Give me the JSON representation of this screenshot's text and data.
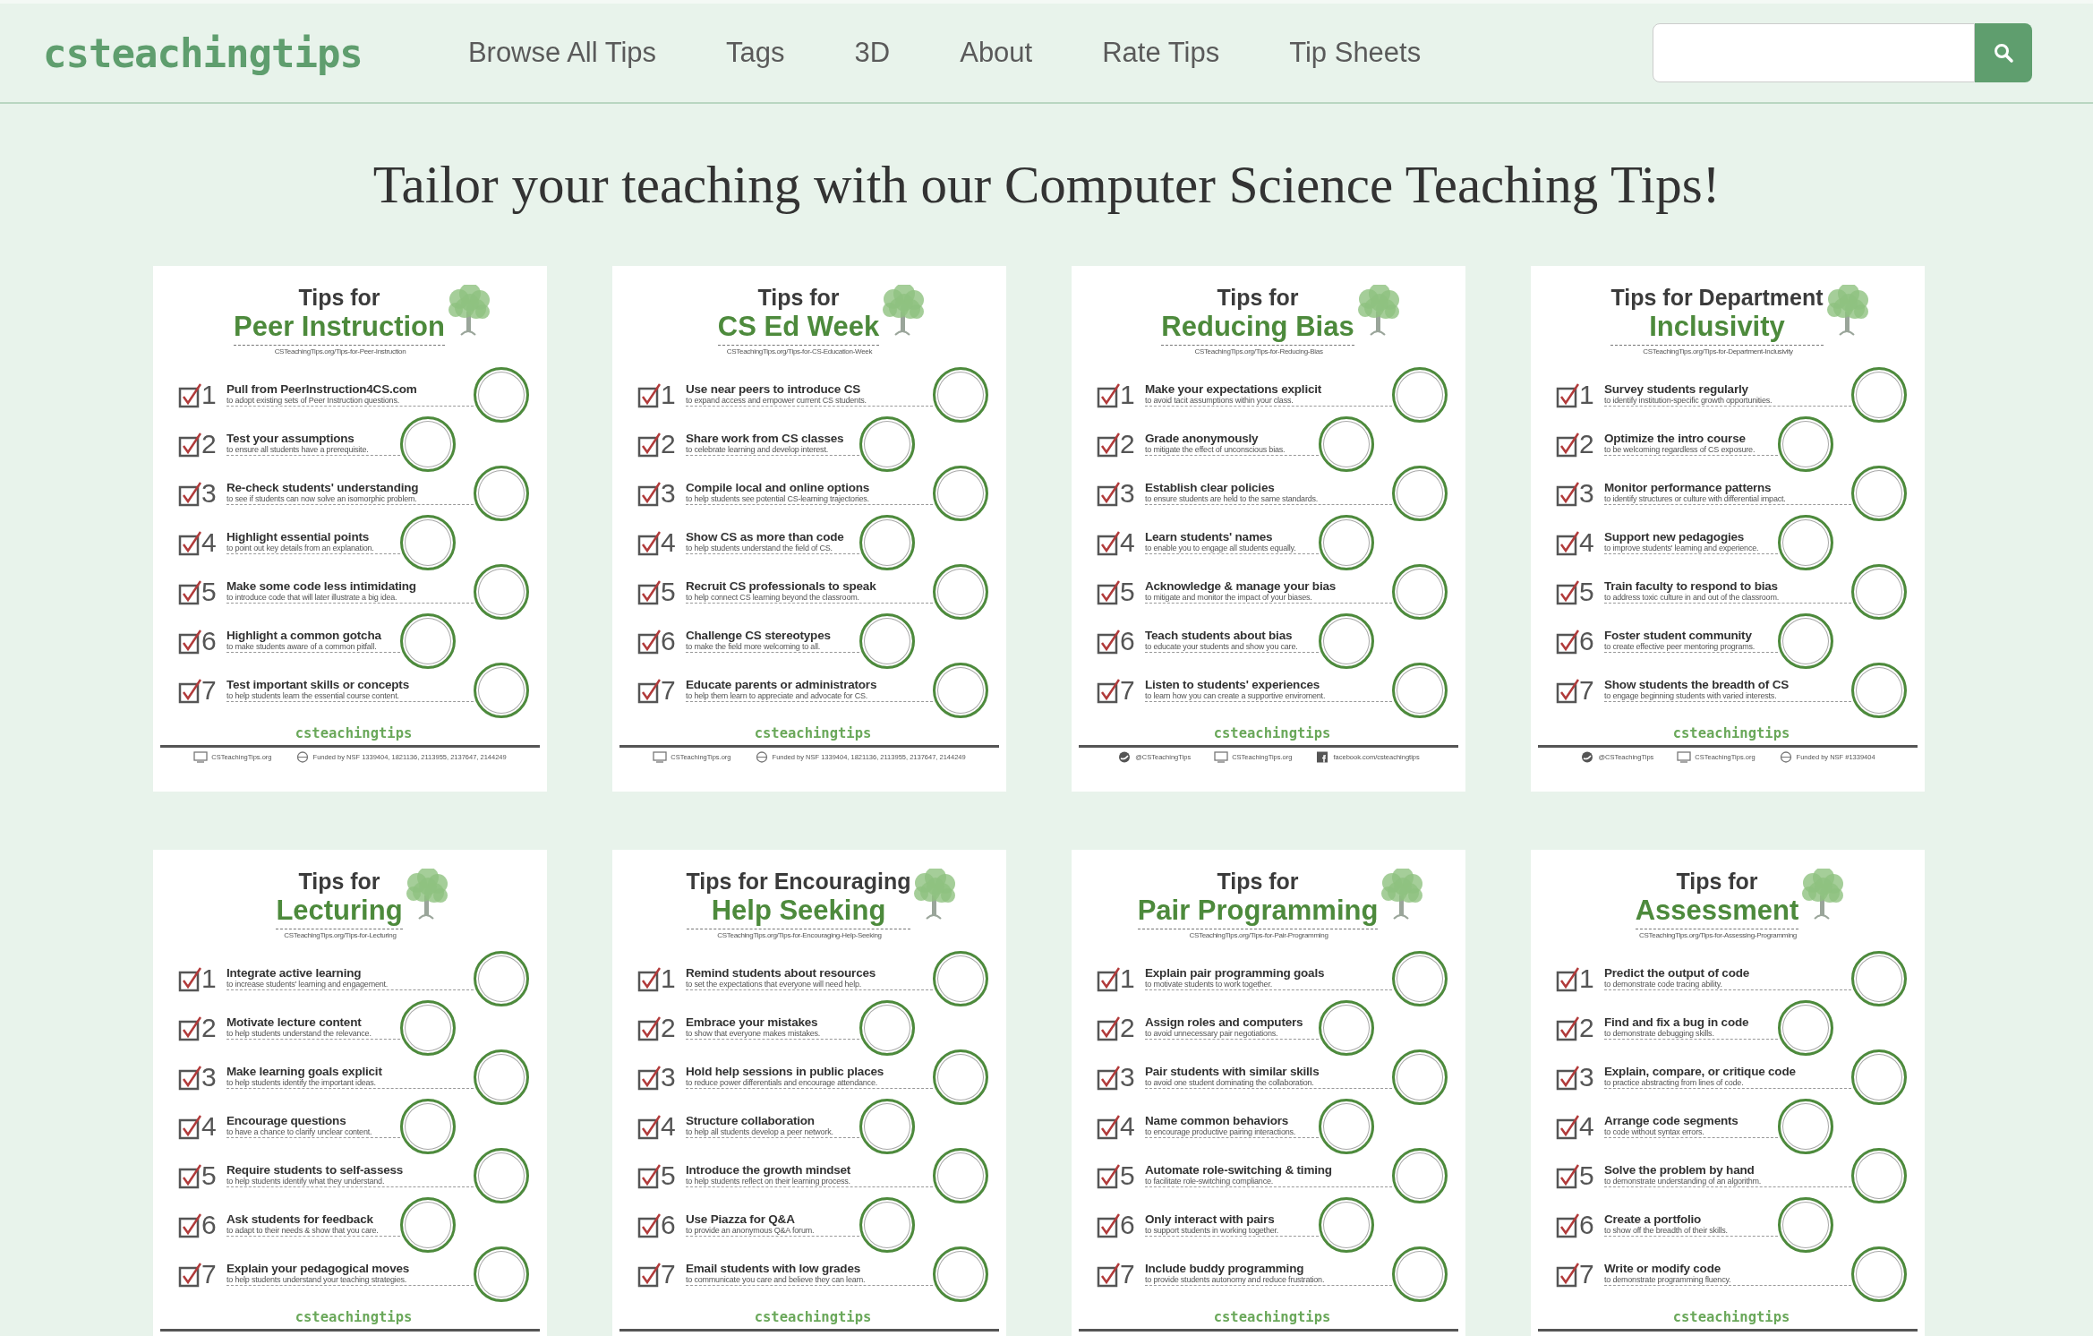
{
  "navbar": {
    "logo": "csteachingtips",
    "links": [
      "Browse All Tips",
      "Tags",
      "3D",
      "About",
      "Rate Tips",
      "Tip Sheets"
    ]
  },
  "heading": "Tailor your teaching with our Computer Science Teaching Tips!",
  "sheets": [
    {
      "title_top": "Tips for",
      "title_main": "Peer Instruction",
      "url": "CSTeachingTips.org/Tips-for-Peer-Instruction",
      "tips": [
        {
          "number": "1",
          "title": "Pull from PeerInstruction4CS.com",
          "note": "to adopt existing sets of Peer Instruction questions."
        },
        {
          "number": "2",
          "title": "Test your assumptions",
          "note": "to ensure all students have a prerequisite."
        },
        {
          "number": "3",
          "title": "Re-check students' understanding",
          "note": "to see if students can now solve an isomorphic problem."
        },
        {
          "number": "4",
          "title": "Highlight essential points",
          "note": "to point out key details from an explanation."
        },
        {
          "number": "5",
          "title": "Make some code less intimidating",
          "note": "to introduce code that will later illustrate a big idea."
        },
        {
          "number": "6",
          "title": "Highlight a common gotcha",
          "note": "to make students aware of a common pitfall."
        },
        {
          "number": "7",
          "title": "Test important skills or concepts",
          "note": "to help students learn the essential course content."
        }
      ],
      "brand": "csteachingtips",
      "footer": [
        {
          "kind": "web",
          "text": "CSTeachingTips.org"
        },
        {
          "kind": "funding",
          "text": "Funded by NSF 1339404, 1821136, 2113955, 2137647, 2144249"
        }
      ]
    },
    {
      "title_top": "Tips for",
      "title_main": "CS Ed Week",
      "url": "CSTeachingTips.org/Tips-for-CS-Education-Week",
      "tips": [
        {
          "number": "1",
          "title": "Use near peers to introduce CS",
          "note": "to expand access and empower current CS students."
        },
        {
          "number": "2",
          "title": "Share work from CS classes",
          "note": "to celebrate learning and develop interest."
        },
        {
          "number": "3",
          "title": "Compile local and online options",
          "note": "to help students see potential CS-learning trajectories."
        },
        {
          "number": "4",
          "title": "Show CS as more than code",
          "note": "to help students understand the field of CS."
        },
        {
          "number": "5",
          "title": "Recruit CS professionals to speak",
          "note": "to help connect CS learning beyond the classroom."
        },
        {
          "number": "6",
          "title": "Challenge CS stereotypes",
          "note": "to make the field more welcoming to all."
        },
        {
          "number": "7",
          "title": "Educate parents or administrators",
          "note": "to help them learn to appreciate and advocate for CS."
        }
      ],
      "brand": "csteachingtips",
      "footer": [
        {
          "kind": "web",
          "text": "CSTeachingTips.org"
        },
        {
          "kind": "funding",
          "text": "Funded by NSF 1339404, 1821136, 2113955, 2137647, 2144249"
        }
      ]
    },
    {
      "title_top": "Tips for",
      "title_main": "Reducing Bias",
      "url": "CSTeachingTips.org/Tips-for-Reducing-Bias",
      "tips": [
        {
          "number": "1",
          "title": "Make your expectations explicit",
          "note": "to avoid tacit assumptions within your class."
        },
        {
          "number": "2",
          "title": "Grade anonymously",
          "note": "to mitigate the effect of unconscious bias."
        },
        {
          "number": "3",
          "title": "Establish clear policies",
          "note": "to ensure students are held to the same standards."
        },
        {
          "number": "4",
          "title": "Learn students' names",
          "note": "to enable you to engage all students equally."
        },
        {
          "number": "5",
          "title": "Acknowledge & manage your bias",
          "note": "to mitigate and monitor the impact of your biases."
        },
        {
          "number": "6",
          "title": "Teach students about bias",
          "note": "to educate your students and show you care."
        },
        {
          "number": "7",
          "title": "Listen to students' experiences",
          "note": "to learn how you can create a supportive enviroment."
        }
      ],
      "brand": "csteachingtips",
      "footer": [
        {
          "kind": "social",
          "text": "@CSTeachingTips"
        },
        {
          "kind": "web",
          "text": "CSTeachingTips.org"
        },
        {
          "kind": "facebook",
          "text": "facebook.com/csteachingtips"
        }
      ]
    },
    {
      "title_top": "Tips for Department",
      "title_main": "Inclusivity",
      "url": "CSTeachingTips.org/Tips-for-Department-Inclusivity",
      "tips": [
        {
          "number": "1",
          "title": "Survey students regularly",
          "note": "to identify institution-specific growth opportunities."
        },
        {
          "number": "2",
          "title": "Optimize the intro course",
          "note": "to be welcoming regardless of CS exposure."
        },
        {
          "number": "3",
          "title": "Monitor performance patterns",
          "note": "to identify structures or culture with differential impact."
        },
        {
          "number": "4",
          "title": "Support new pedagogies",
          "note": "to improve students' learning and experience."
        },
        {
          "number": "5",
          "title": "Train faculty to respond to bias",
          "note": "to address toxic culture in and out of the classroom."
        },
        {
          "number": "6",
          "title": "Foster student community",
          "note": "to create effective peer mentoring programs."
        },
        {
          "number": "7",
          "title": "Show students the breadth of CS",
          "note": "to engage beginning students with varied interests."
        }
      ],
      "brand": "csteachingtips",
      "footer": [
        {
          "kind": "social",
          "text": "@CSTeachingTips"
        },
        {
          "kind": "web",
          "text": "CSTeachingTips.org"
        },
        {
          "kind": "funding",
          "text": "Funded by NSF #1339404"
        }
      ]
    },
    {
      "title_top": "Tips for",
      "title_main": "Lecturing",
      "url": "CSTeachingTips.org/Tips-for-Lecturing",
      "tips": [
        {
          "number": "1",
          "title": "Integrate active learning",
          "note": "to increase students' learning and engagement."
        },
        {
          "number": "2",
          "title": "Motivate lecture content",
          "note": "to help students understand the relevance."
        },
        {
          "number": "3",
          "title": "Make learning goals explicit",
          "note": "to help students identify the important ideas."
        },
        {
          "number": "4",
          "title": "Encourage questions",
          "note": "to have a chance to clarify unclear content."
        },
        {
          "number": "5",
          "title": "Require students to self-assess",
          "note": "to help students identify what they understand."
        },
        {
          "number": "6",
          "title": "Ask students for feedback",
          "note": "to adapt to their needs & show that you care."
        },
        {
          "number": "7",
          "title": "Explain your pedagogical moves",
          "note": "to help students understand your teaching strategies."
        }
      ],
      "brand": "csteachingtips"
    },
    {
      "title_top": "Tips for Encouraging",
      "title_main": "Help Seeking",
      "url": "CSTeachingTips.org/Tips-for-Encouraging-Help-Seeking",
      "tips": [
        {
          "number": "1",
          "title": "Remind students about resources",
          "note": "to set the expectations that everyone will need help."
        },
        {
          "number": "2",
          "title": "Embrace your mistakes",
          "note": "to show that everyone makes mistakes."
        },
        {
          "number": "3",
          "title": "Hold help sessions in public places",
          "note": "to reduce power differentials and encourage attendance."
        },
        {
          "number": "4",
          "title": "Structure collaboration",
          "note": "to help all students develop a peer network."
        },
        {
          "number": "5",
          "title": "Introduce the growth mindset",
          "note": "to help students reflect on their learning process."
        },
        {
          "number": "6",
          "title": "Use Piazza for Q&A",
          "note": "to provide an anonymous Q&A forum."
        },
        {
          "number": "7",
          "title": "Email students with low grades",
          "note": "to communicate you care and believe they can learn."
        }
      ],
      "brand": "csteachingtips"
    },
    {
      "title_top": "Tips for",
      "title_main": "Pair Programming",
      "url": "CSTeachingTips.org/Tips-for-Pair-Programming",
      "tips": [
        {
          "number": "1",
          "title": "Explain pair programming goals",
          "note": "to motivate students to work together."
        },
        {
          "number": "2",
          "title": "Assign roles and computers",
          "note": "to avoid unnecessary pair negotiations."
        },
        {
          "number": "3",
          "title": "Pair students with similar skills",
          "note": "to avoid one student dominating the collaboration."
        },
        {
          "number": "4",
          "title": "Name common behaviors",
          "note": "to encourage productive pairing interactions."
        },
        {
          "number": "5",
          "title": "Automate role-switching & timing",
          "note": "to facilitate role-switching compliance."
        },
        {
          "number": "6",
          "title": "Only interact with pairs",
          "note": "to support students in working together."
        },
        {
          "number": "7",
          "title": "Include buddy programming",
          "note": "to provide students autonomy and reduce frustration."
        }
      ],
      "brand": "csteachingtips"
    },
    {
      "title_top": "Tips for",
      "title_main": "Assessment",
      "url": "CSTeachingTips.org/Tips-for-Assessing-Programming",
      "tips": [
        {
          "number": "1",
          "title": "Predict the output of code",
          "note": "to demonstrate code tracing ability."
        },
        {
          "number": "2",
          "title": "Find and fix a bug in code",
          "note": "to demonstrate debugging skills."
        },
        {
          "number": "3",
          "title": "Explain, compare, or critique code",
          "note": "to practice abstracting from lines of code."
        },
        {
          "number": "4",
          "title": "Arrange code segments",
          "note": "to code without syntax errors."
        },
        {
          "number": "5",
          "title": "Solve the problem by hand",
          "note": "to demonstrate understanding of an algorithm."
        },
        {
          "number": "6",
          "title": "Create a portfolio",
          "note": "to show off the breadth of their skills."
        },
        {
          "number": "7",
          "title": "Write or modify code",
          "note": "to demonstrate programming fluency."
        }
      ],
      "brand": "csteachingtips"
    }
  ]
}
